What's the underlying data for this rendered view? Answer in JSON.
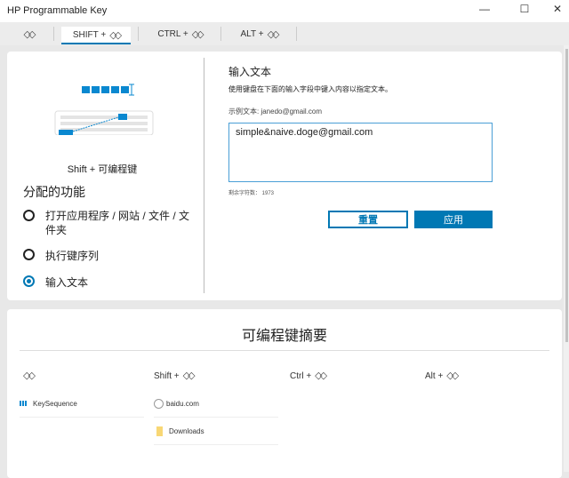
{
  "window": {
    "title": "HP Programmable Key",
    "minimize": "—",
    "maximize": "☐",
    "close": "✕"
  },
  "tabs": [
    {
      "label": ""
    },
    {
      "label": "SHIFT +"
    },
    {
      "label": "CTRL +"
    },
    {
      "label": "ALT +"
    }
  ],
  "key_glyph": "◇◇",
  "illustration": {
    "caption": "Shift + 可编程键"
  },
  "function": {
    "heading": "分配的功能",
    "options": [
      {
        "label": "打开应用程序 / 网站 / 文件 / 文件夹",
        "selected": false
      },
      {
        "label": "执行键序列",
        "selected": false
      },
      {
        "label": "输入文本",
        "selected": true
      }
    ]
  },
  "text_input": {
    "heading": "输入文本",
    "description": "使用键盘在下面的输入字段中键入内容以指定文本。",
    "example": "示例文本: janedo@gmail.com",
    "value": "simple&naive.doge@gmail.com",
    "remaining": "剩余字符数： 1973"
  },
  "buttons": {
    "reset": "重置",
    "apply": "应用"
  },
  "summary": {
    "title": "可编程键摘要",
    "columns": [
      {
        "label": "",
        "items": [
          {
            "icon": "keysequence-icon",
            "label": "KeySequence"
          }
        ]
      },
      {
        "label": "Shift +",
        "items": [
          {
            "icon": "globe-icon",
            "label": "baidu.com"
          },
          {
            "icon": "folder-icon",
            "label": "Downloads"
          }
        ]
      },
      {
        "label": "Ctrl +",
        "items": []
      },
      {
        "label": "Alt +",
        "items": []
      }
    ]
  },
  "colors": {
    "accent": "#0078b4"
  }
}
